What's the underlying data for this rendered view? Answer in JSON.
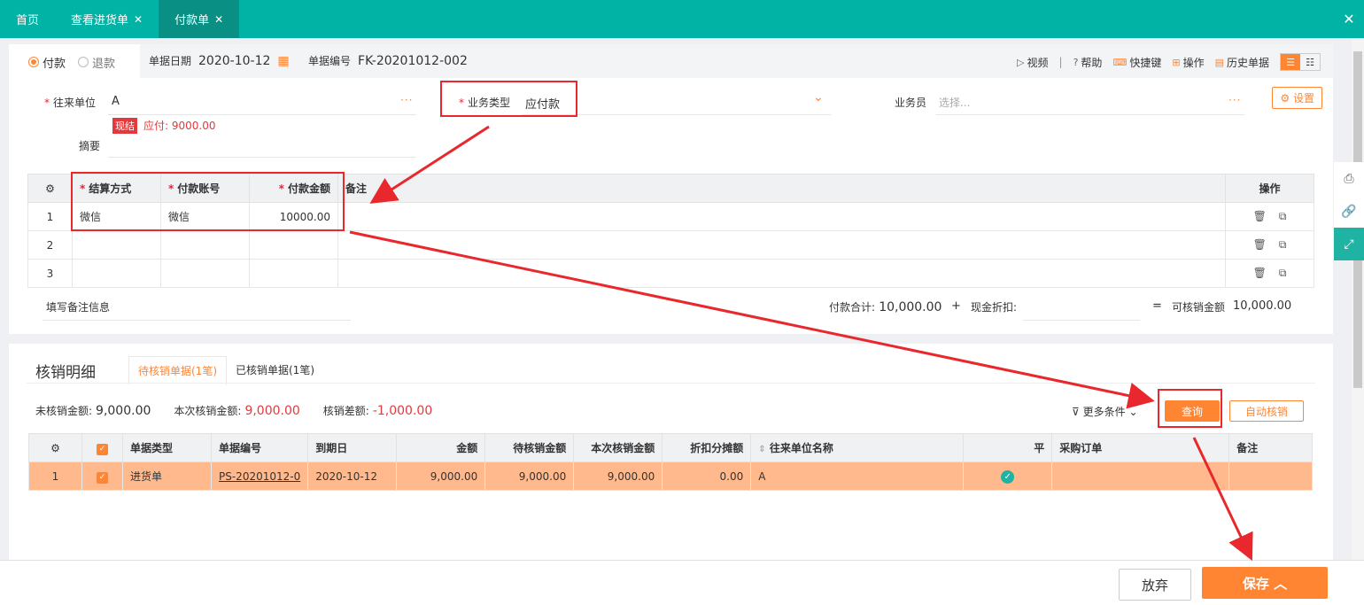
{
  "tabs": [
    {
      "label": "首页",
      "closable": false
    },
    {
      "label": "查看进货单",
      "closable": true
    },
    {
      "label": "付款单",
      "closable": true,
      "active": true
    }
  ],
  "close_all": "✕",
  "header": {
    "radio_pay": "付款",
    "radio_refund": "退款",
    "date_label": "单据日期",
    "date_value": "2020-10-12",
    "no_label": "单据编号",
    "no_value": "FK-20201012-002",
    "toolbar": {
      "video": "视频",
      "help": "帮助",
      "shortcut": "快捷键",
      "operate": "操作",
      "history": "历史单据"
    }
  },
  "form": {
    "partner_label": "往来单位",
    "partner_value": "A",
    "cash_badge": "现结",
    "payable_text": "应付: 9000.00",
    "memo_label": "摘要",
    "biztype_label": "业务类型",
    "biztype_value": "应付款",
    "staff_label": "业务员",
    "staff_placeholder": "选择...",
    "settings_button": "设置"
  },
  "pay_table": {
    "headers": [
      "结算方式",
      "付款账号",
      "付款金额",
      "备注",
      "操作"
    ],
    "rows": [
      {
        "no": "1",
        "method": "微信",
        "account": "微信",
        "amount": "10000.00"
      },
      {
        "no": "2",
        "method": "",
        "account": "",
        "amount": ""
      },
      {
        "no": "3",
        "method": "",
        "account": "",
        "amount": ""
      }
    ]
  },
  "summary": {
    "remark_placeholder": "填写备注信息",
    "pay_total_label": "付款合计:",
    "pay_total_value": "10,000.00",
    "plus": "+",
    "discount_label": "现金折扣:",
    "eq": "=",
    "writeoff_label": "可核销金额",
    "writeoff_value": "10,000.00"
  },
  "writeoff": {
    "title": "核销明细",
    "tab_pending": "待核销单据(1笔)",
    "tab_done": "已核销单据(1笔)",
    "unwritten_label": "未核销金额:",
    "unwritten_value": "9,000.00",
    "current_label": "本次核销金额:",
    "current_value": "9,000.00",
    "diff_label": "核销差额:",
    "diff_value": "-1,000.00",
    "more_conditions": "更多条件",
    "query_button": "查询",
    "auto_button": "自动核销",
    "headers": [
      "单据类型",
      "单据编号",
      "到期日",
      "金额",
      "待核销金额",
      "本次核销金额",
      "折扣分摊额",
      "往来单位名称",
      "平",
      "采购订单",
      "备注"
    ],
    "rows": [
      {
        "no": "1",
        "type": "进货单",
        "code": "PS-20201012-0",
        "due": "2020-10-12",
        "amount": "9,000.00",
        "pending": "9,000.00",
        "current": "9,000.00",
        "discount": "0.00",
        "partner": "A",
        "order": "",
        "remark": ""
      }
    ]
  },
  "footer": {
    "abandon": "放弃",
    "save": "保存"
  },
  "colors": {
    "teal": "#00b3a4",
    "orange": "#ff8533",
    "red": "#e4393c",
    "row_highlight": "#ffb98c"
  }
}
